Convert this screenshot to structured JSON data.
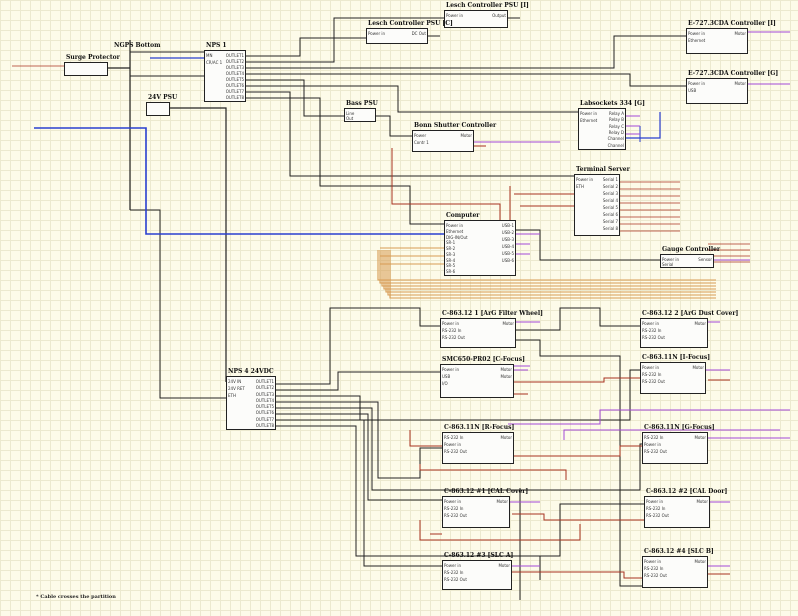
{
  "note": "* Cable crosses the partition",
  "blocks": [
    {
      "id": "surge",
      "title": "Surge Protector"
    },
    {
      "id": "ngps",
      "title": "NGPS Bottom"
    },
    {
      "id": "nps1",
      "title": "NPS 1",
      "left": [
        "MN",
        "CR/AC 1"
      ],
      "right": [
        "OUTLET1",
        "OUTLET2",
        "OUTLET3",
        "OUTLET4",
        "OUTLET5",
        "OUTLET6",
        "OUTLET7",
        "OUTLET8"
      ]
    },
    {
      "id": "psu24",
      "title": "24V PSU"
    },
    {
      "id": "lcpsu1",
      "title": "Lesch Controller PSU [I]",
      "left": [
        "Power in"
      ],
      "right": [
        "Output"
      ]
    },
    {
      "id": "lcpsu2",
      "title": "Lesch Controller PSU [C]",
      "left": [
        "Power in"
      ],
      "right": [
        "DC Out"
      ]
    },
    {
      "id": "e727i",
      "title": "E-727.3CDA Controller [I]",
      "left": [
        "Power in",
        "Ethernet"
      ],
      "right": [
        "Motor"
      ]
    },
    {
      "id": "e727g",
      "title": "E-727.3CDA Controller [G]",
      "left": [
        "Power in",
        "USB"
      ],
      "right": [
        "Motor"
      ]
    },
    {
      "id": "basspsu",
      "title": "Bass PSU",
      "left": [
        "Line",
        "Out"
      ]
    },
    {
      "id": "labsocket",
      "title": "Labsockets 334 [G]",
      "left": [
        "Power in",
        "Ethernet"
      ],
      "right": [
        "Relay A",
        "Relay B",
        "Relay C",
        "Relay D",
        "Channel",
        "Channel"
      ]
    },
    {
      "id": "shutter",
      "title": "Bonn Shutter Controller",
      "left": [
        "Power",
        "Contr 1"
      ],
      "right": [
        "Motor"
      ]
    },
    {
      "id": "tserver",
      "title": "Terminal Server",
      "left": [
        "Power in",
        "ETH"
      ],
      "right": [
        "Serial 1",
        "Serial 2",
        "Serial 3",
        "Serial 4",
        "Serial 5",
        "Serial 6",
        "Serial 7",
        "Serial 8"
      ]
    },
    {
      "id": "computer",
      "title": "Computer",
      "left": [
        "Power in",
        "Ethernet",
        "DIG-IN/Out",
        "SR-1",
        "SR-2",
        "SR-3",
        "SR-4",
        "SR-5",
        "SR-6"
      ],
      "right": [
        "USB-1",
        "USB-2",
        "USB-3",
        "USB-4",
        "USB-5",
        "USB-6"
      ]
    },
    {
      "id": "gauge",
      "title": "Gauge Controller",
      "left": [
        "Power in",
        "Serial"
      ],
      "right": [
        "Sensor"
      ]
    },
    {
      "id": "c1",
      "title": "C-863.12 1 [ArG Filter Wheel]",
      "left": [
        "Power in",
        "RS-232 In",
        "RS-232 Out"
      ],
      "right": [
        "Motor"
      ]
    },
    {
      "id": "c2",
      "title": "C-863.12 2 [ArG Dust Cover]",
      "left": [
        "Power in",
        "RS-232 In",
        "RS-232 Out"
      ],
      "right": [
        "Motor"
      ]
    },
    {
      "id": "smc",
      "title": "SMC650-PR02 [C-Focus]",
      "left": [
        "Power in",
        "USB",
        "I/O"
      ],
      "right": [
        "Motor",
        "Motor"
      ]
    },
    {
      "id": "c3",
      "title": "C-863.11N [I-Focus]",
      "left": [
        "Power in",
        "RS-232 In",
        "RS-232 Out"
      ],
      "right": [
        "Motor"
      ]
    },
    {
      "id": "nps4",
      "title": "NPS 4 24VDC",
      "left": [
        "24V IN",
        "24V RET",
        "ETH"
      ],
      "right": [
        "OUTLET1",
        "OUTLET2",
        "OUTLET3",
        "OUTLET4",
        "OUTLET5",
        "OUTLET6",
        "OUTLET7",
        "OUTLET8"
      ]
    },
    {
      "id": "c4",
      "title": "C-863.11N [R-Focus]",
      "left": [
        "RS-232 In",
        "Power in",
        "RS-232 Out"
      ],
      "right": [
        "Motor"
      ]
    },
    {
      "id": "c5",
      "title": "C-863.11N [G-Focus]",
      "left": [
        "RS-232 In",
        "Power in",
        "RS-232 Out"
      ],
      "right": [
        "Motor"
      ]
    },
    {
      "id": "c6",
      "title": "C-863.12 #1 [CAL Cover]",
      "left": [
        "Power in",
        "RS-232 In",
        "RS-232 Out"
      ],
      "right": [
        "Motor"
      ]
    },
    {
      "id": "c7",
      "title": "C-863.12 #2 [CAL Door]",
      "left": [
        "Power in",
        "RS-232 In",
        "RS-232 Out"
      ],
      "right": [
        "Motor"
      ]
    },
    {
      "id": "c8",
      "title": "C-863.12 #3 [SLC A]",
      "left": [
        "Power in",
        "RS-232 In",
        "RS-232 Out"
      ],
      "right": [
        "Motor"
      ]
    },
    {
      "id": "c9",
      "title": "C-863.12 #4 [SLC B]",
      "left": [
        "Power in",
        "RS-232 In",
        "RS-232 Out"
      ],
      "right": [
        "Motor"
      ]
    }
  ]
}
